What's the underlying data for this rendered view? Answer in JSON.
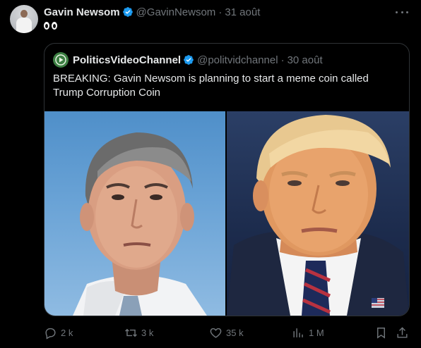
{
  "tweet": {
    "author_name": "Gavin Newsom",
    "author_handle": "@GavinNewsom",
    "separator": "·",
    "date": "31 août",
    "text_emoji": "eyes-emoji"
  },
  "quoted": {
    "author_name": "PoliticsVideoChannel",
    "author_handle": "@politvidchannel",
    "separator": "·",
    "date": "30 août",
    "text": "BREAKING: Gavin Newsom is planning to start a meme coin called Trump Corruption Coin",
    "photos": [
      "newsom-portrait-photo",
      "trump-portrait-photo"
    ]
  },
  "actions": {
    "replies": "2 k",
    "reposts": "3 k",
    "likes": "35 k",
    "views": "1 M"
  },
  "colors": {
    "background": "#000000",
    "text_primary": "#e7e9ea",
    "text_secondary": "#71767b",
    "verified_blue": "#1d9bf0",
    "border": "#2f3336",
    "quoted_avatar_green": "#3d7f43"
  }
}
